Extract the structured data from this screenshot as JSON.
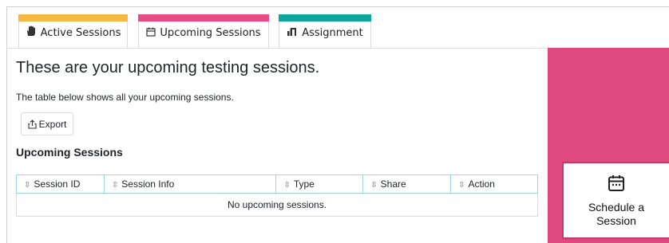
{
  "tabs": [
    {
      "label": "Active Sessions",
      "icon": "hand-icon",
      "stripe_color": "#f5b942"
    },
    {
      "label": "Upcoming Sessions",
      "icon": "calendar-icon",
      "stripe_color": "#e84c84",
      "active": true
    },
    {
      "label": "Assignment",
      "icon": "assignment-icon",
      "stripe_color": "#0ea59a"
    }
  ],
  "main": {
    "heading": "These are your upcoming testing sessions.",
    "description": "The table below shows all your upcoming sessions.",
    "export_label": "Export",
    "section_title": "Upcoming Sessions"
  },
  "table": {
    "columns": [
      "Session ID",
      "Session Info",
      "Type",
      "Share",
      "Action"
    ],
    "empty_message": "No upcoming sessions."
  },
  "side": {
    "panel_color": "#de4a80",
    "schedule_label": "Schedule a Session"
  }
}
